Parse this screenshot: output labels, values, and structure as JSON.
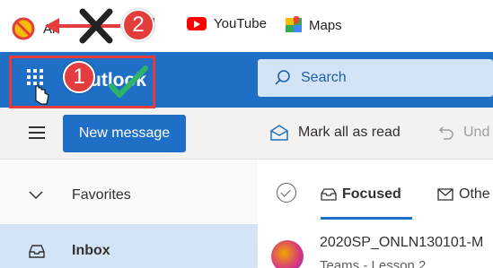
{
  "bookmarks": {
    "items": [
      {
        "label": "Ar",
        "icon": "no-sign-icon"
      },
      {
        "label": "il",
        "icon": "gmail-icon"
      },
      {
        "label": "YouTube",
        "icon": "youtube-icon"
      },
      {
        "label": "Maps",
        "icon": "maps-icon"
      }
    ]
  },
  "header": {
    "app_name": "utlook",
    "search_placeholder": "Search"
  },
  "commands": {
    "new_message": "New message",
    "mark_all_read": "Mark all as read",
    "undo": "Und"
  },
  "nav": {
    "favorites": "Favorites",
    "inbox": "Inbox"
  },
  "message_list": {
    "tab_focused": "Focused",
    "tab_other": "Othe",
    "first_message_title": "2020SP_ONLN130101-M",
    "first_message_preview": "Teams - Lesson 2"
  },
  "annotations": {
    "step1": "1",
    "step2": "2"
  },
  "colors": {
    "outlook_blue": "#1f6fc6",
    "annotation_red": "#e43d3d",
    "check_green": "#2fb36b"
  }
}
